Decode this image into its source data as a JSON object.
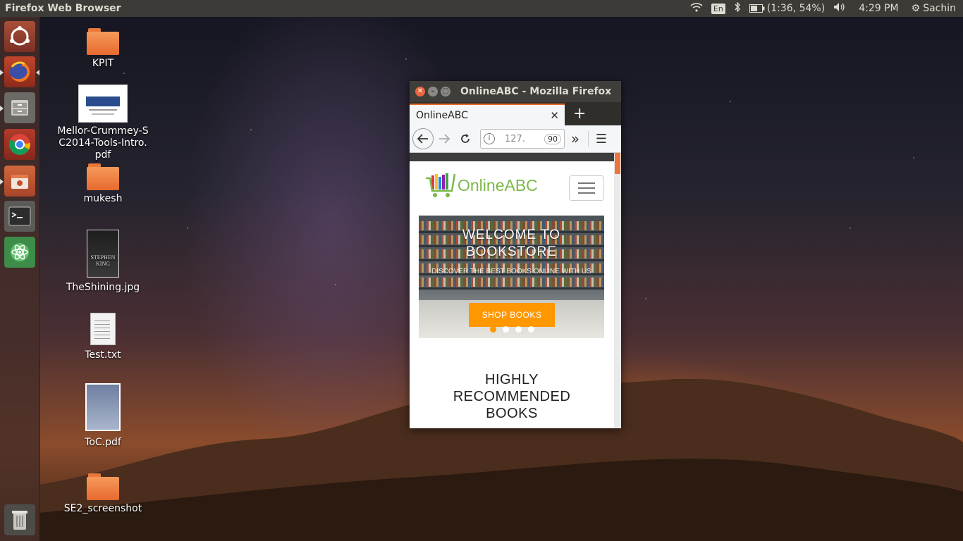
{
  "topbar": {
    "app_title": "Firefox Web Browser",
    "keyboard_layout": "En",
    "battery": "(1:36, 54%)",
    "time": "4:29 PM",
    "user": "Sachin"
  },
  "launcher": {
    "items": [
      {
        "name": "Ubuntu dash",
        "icon": "ubuntu-icon"
      },
      {
        "name": "Firefox",
        "icon": "firefox-icon"
      },
      {
        "name": "Files",
        "icon": "files-icon"
      },
      {
        "name": "Chrome",
        "icon": "chrome-icon"
      },
      {
        "name": "Software",
        "icon": "software-icon"
      },
      {
        "name": "Terminal",
        "icon": "terminal-icon"
      },
      {
        "name": "Atom",
        "icon": "atom-icon"
      },
      {
        "name": "Trash",
        "icon": "trash-icon"
      }
    ]
  },
  "desktop": {
    "icons": [
      {
        "label": "KPIT",
        "type": "folder"
      },
      {
        "label": "Mellor-Crummey-SC2014-Tools-Intro.pdf",
        "type": "pdf"
      },
      {
        "label": "mukesh",
        "type": "folder"
      },
      {
        "label": "TheShining.jpg",
        "type": "image"
      },
      {
        "label": "Test.txt",
        "type": "text"
      },
      {
        "label": "ToC.pdf",
        "type": "pdf"
      },
      {
        "label": "SE2_screenshot",
        "type": "folder"
      }
    ],
    "book_cover_text": "STEPHEN KING"
  },
  "firefox": {
    "window_title": "OnlineABC - Mozilla Firefox",
    "tab_title": "OnlineABC",
    "url": "127.",
    "zoom": "90",
    "page": {
      "logo_text": "OnlineABC",
      "hero_title": "WELCOME TO BOOKSTORE",
      "hero_subtitle": "DISCOVER THE BEST BOOKS ONLINE WITH US",
      "cta": "SHOP BOOKS",
      "section_title": "HIGHLY RECOMMENDED BOOKS",
      "carousel": {
        "count": 4,
        "active": 1
      }
    }
  },
  "colors": {
    "accent": "#ff9800",
    "logo_green": "#7bb84a",
    "firefox_tab_accent": "#e8692e"
  }
}
